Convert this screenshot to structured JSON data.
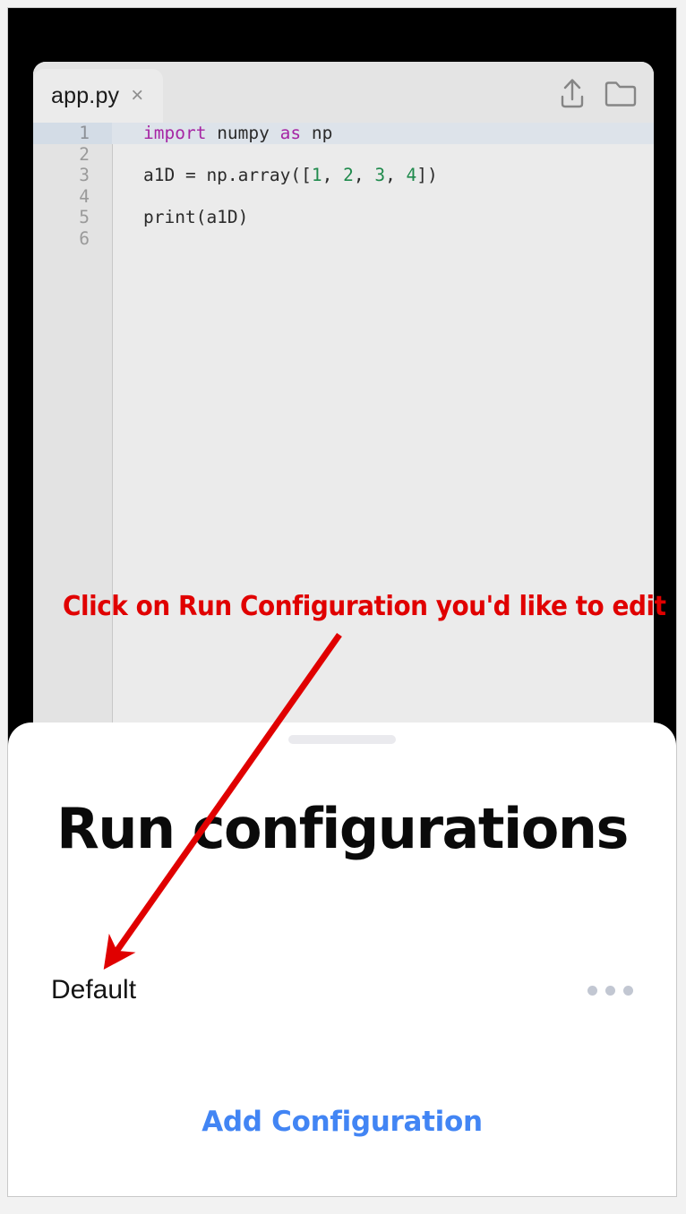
{
  "editor": {
    "tab": {
      "label": "app.py",
      "close_glyph": "×"
    },
    "toolbar": {
      "share_icon": "share-upload-icon",
      "folder_icon": "folder-icon"
    },
    "gutter_numbers": [
      "1",
      "2",
      "3",
      "4",
      "5",
      "6"
    ],
    "code_lines": [
      {
        "n": "1",
        "active": true,
        "tokens": [
          {
            "t": "import",
            "c": "kw"
          },
          {
            "t": " numpy ",
            "c": ""
          },
          {
            "t": "as",
            "c": "kw"
          },
          {
            "t": " np",
            "c": ""
          }
        ]
      },
      {
        "n": "2",
        "active": false,
        "tokens": [
          {
            "t": "",
            "c": ""
          }
        ]
      },
      {
        "n": "3",
        "active": false,
        "tokens": [
          {
            "t": "a1D = np.array([",
            "c": ""
          },
          {
            "t": "1",
            "c": "num"
          },
          {
            "t": ", ",
            "c": ""
          },
          {
            "t": "2",
            "c": "num"
          },
          {
            "t": ", ",
            "c": ""
          },
          {
            "t": "3",
            "c": "num"
          },
          {
            "t": ", ",
            "c": ""
          },
          {
            "t": "4",
            "c": "num"
          },
          {
            "t": "])",
            "c": ""
          }
        ]
      },
      {
        "n": "4",
        "active": false,
        "tokens": [
          {
            "t": "",
            "c": ""
          }
        ]
      },
      {
        "n": "5",
        "active": false,
        "tokens": [
          {
            "t": "print(a1D)",
            "c": ""
          }
        ]
      },
      {
        "n": "6",
        "active": false,
        "tokens": [
          {
            "t": "",
            "c": ""
          }
        ]
      }
    ]
  },
  "sheet": {
    "title": "Run configurations",
    "configurations": [
      {
        "name": "Default",
        "more_label": "•••"
      }
    ],
    "add_button_label": "Add Configuration"
  },
  "annotation": {
    "text": "Click on Run Configuration you'd like to edit",
    "arrow_color": "#e00000",
    "text_color": "#e00000",
    "text_outline_color": "#ffffff"
  },
  "colors": {
    "accent_blue": "#4285f4",
    "editor_bg": "#ebebeb",
    "gutter_bg": "#e3e3e3",
    "active_line_bg": "#dde3ea",
    "keyword_purple": "#a626a4",
    "number_green": "#1f8a4c",
    "sheet_bg": "#ffffff",
    "frame_black": "#000000"
  }
}
